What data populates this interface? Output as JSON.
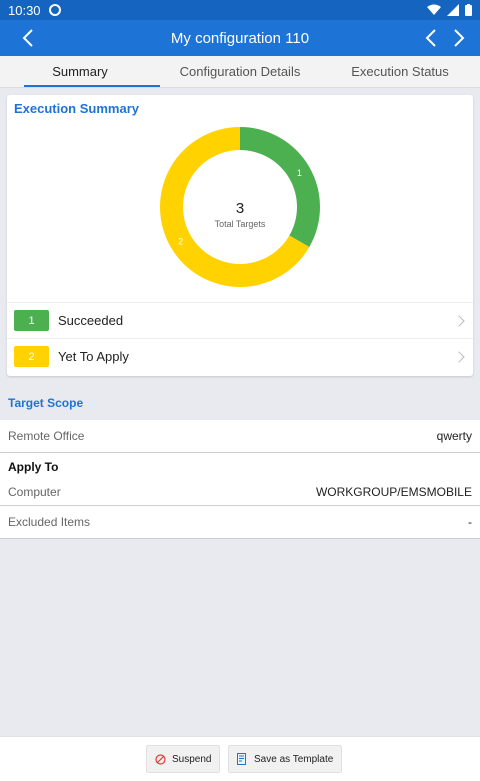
{
  "status_bar": {
    "time": "10:30",
    "icons": [
      "sync-icon",
      "wifi-icon",
      "signal-icon",
      "battery-icon"
    ]
  },
  "app_bar": {
    "title": "My configuration 110",
    "back_icon": "back-arrow-icon",
    "prev_icon": "chevron-left-icon",
    "next_icon": "chevron-right-icon"
  },
  "tabs": [
    {
      "label": "Summary",
      "active": true
    },
    {
      "label": "Configuration Details",
      "active": false
    },
    {
      "label": "Execution Status",
      "active": false
    }
  ],
  "execution_summary": {
    "title": "Execution Summary",
    "total": "3",
    "total_label": "Total Targets",
    "colors": {
      "succeeded": "#4caf50",
      "yet_to_apply": "#ffd200"
    },
    "items": [
      {
        "count": "1",
        "label": "Succeeded"
      },
      {
        "count": "2",
        "label": "Yet To Apply"
      }
    ]
  },
  "chart_data": {
    "type": "pie",
    "categories": [
      "Succeeded",
      "Yet To Apply"
    ],
    "values": [
      1,
      2
    ]
  },
  "target_scope": {
    "title": "Target Scope",
    "remote_office_label": "Remote Office",
    "remote_office_value": "qwerty",
    "apply_to_label": "Apply To",
    "computer_label": "Computer",
    "computer_value": "WORKGROUP/EMSMOBILE",
    "excluded_label": "Excluded Items",
    "excluded_value": "-"
  },
  "actions": {
    "suspend": "Suspend",
    "save_template": "Save as Template"
  }
}
